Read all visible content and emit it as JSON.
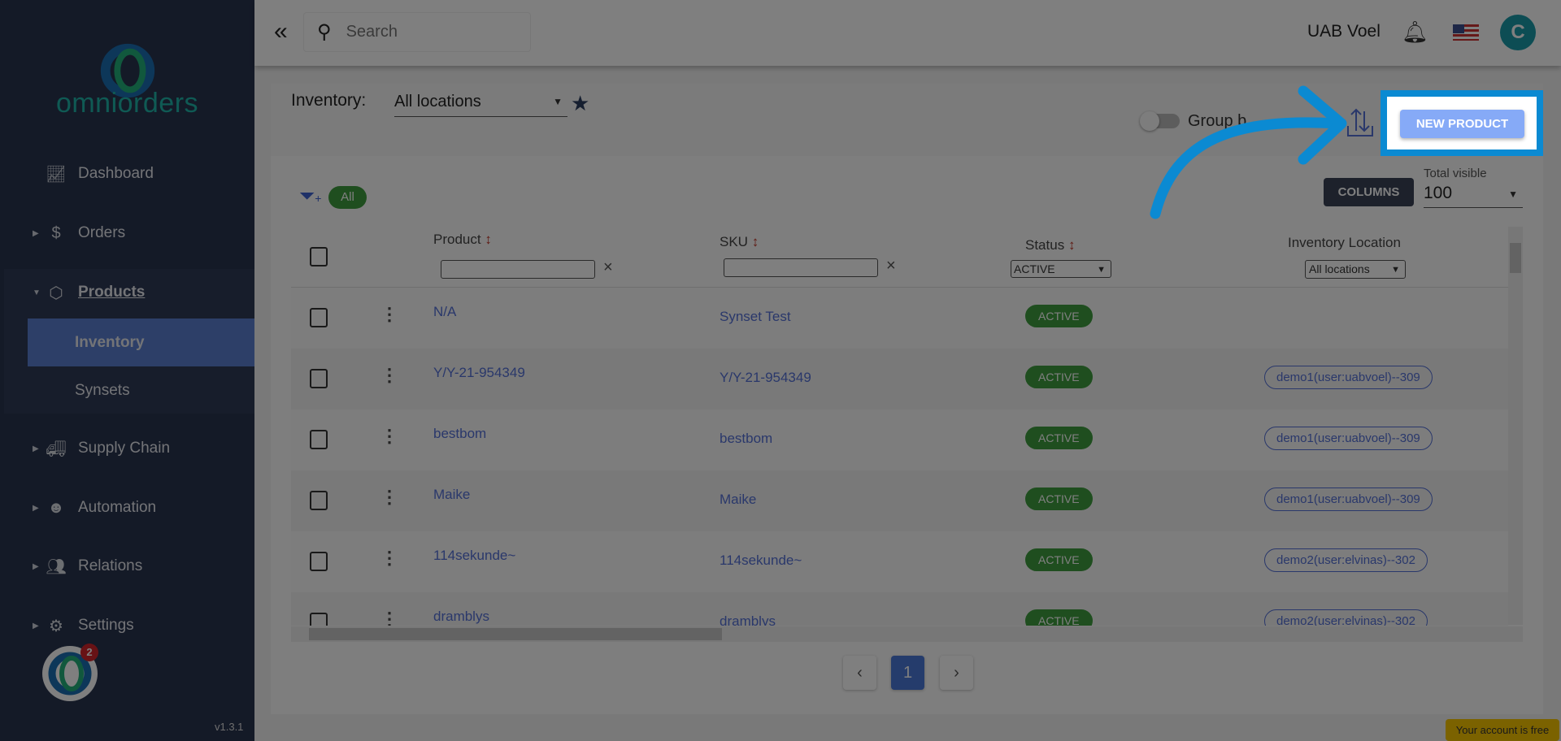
{
  "sidebar": {
    "brand": "omniorders",
    "items": [
      {
        "label": "Dashboard",
        "icon": "chart-line-icon"
      },
      {
        "label": "Orders",
        "icon": "dollar-icon"
      },
      {
        "label": "Products",
        "icon": "box-icon"
      },
      {
        "label": "Supply Chain",
        "icon": "truck-icon"
      },
      {
        "label": "Automation",
        "icon": "robot-icon"
      },
      {
        "label": "Relations",
        "icon": "users-icon"
      },
      {
        "label": "Settings",
        "icon": "gears-icon"
      }
    ],
    "products_sub": [
      {
        "label": "Inventory",
        "active": true
      },
      {
        "label": "Synsets"
      }
    ],
    "notification_count": "2",
    "version": "v1.3.1"
  },
  "topbar": {
    "search_placeholder": "Search",
    "company": "UAB Voel",
    "avatar_letter": "C"
  },
  "page": {
    "title": "Inventory:",
    "location_select": "All locations",
    "group_by_label": "Group b",
    "new_product": "NEW PRODUCT",
    "filter_chip": "All",
    "columns_button": "COLUMNS",
    "total_visible_label": "Total visible",
    "total_visible_value": "100"
  },
  "table": {
    "headers": {
      "product": "Product",
      "sku": "SKU",
      "status": "Status",
      "location": "Inventory Location",
      "sort_glyph": "↕",
      "clear_glyph": "×"
    },
    "status_filter": "ACTIVE",
    "location_filter": "All locations",
    "rows": [
      {
        "product": "N/A",
        "sku": "Synset Test",
        "status": "ACTIVE",
        "location": ""
      },
      {
        "product": "Y/Y-21-954349",
        "sku": "Y/Y-21-954349",
        "status": "ACTIVE",
        "location": "demo1(user:uabvoel)--309"
      },
      {
        "product": "bestbom",
        "sku": "bestbom",
        "status": "ACTIVE",
        "location": "demo1(user:uabvoel)--309"
      },
      {
        "product": "Maike",
        "sku": "Maike",
        "status": "ACTIVE",
        "location": "demo1(user:uabvoel)--309"
      },
      {
        "product": "114sekunde~",
        "sku": "114sekunde~",
        "status": "ACTIVE",
        "location": "demo2(user:elvinas)--302"
      },
      {
        "product": "dramblys",
        "sku": "dramblys",
        "status": "ACTIVE",
        "location": "demo2(user:elvinas)--302"
      }
    ]
  },
  "pagination": {
    "current": "1",
    "prev": "‹",
    "next": "›"
  },
  "footer": {
    "account_notice": "Your account is free"
  },
  "colors": {
    "highlight": "#0b8ad2",
    "accent": "#5470d6",
    "active": "#3f9d3f",
    "sidebar": "#29344f"
  }
}
